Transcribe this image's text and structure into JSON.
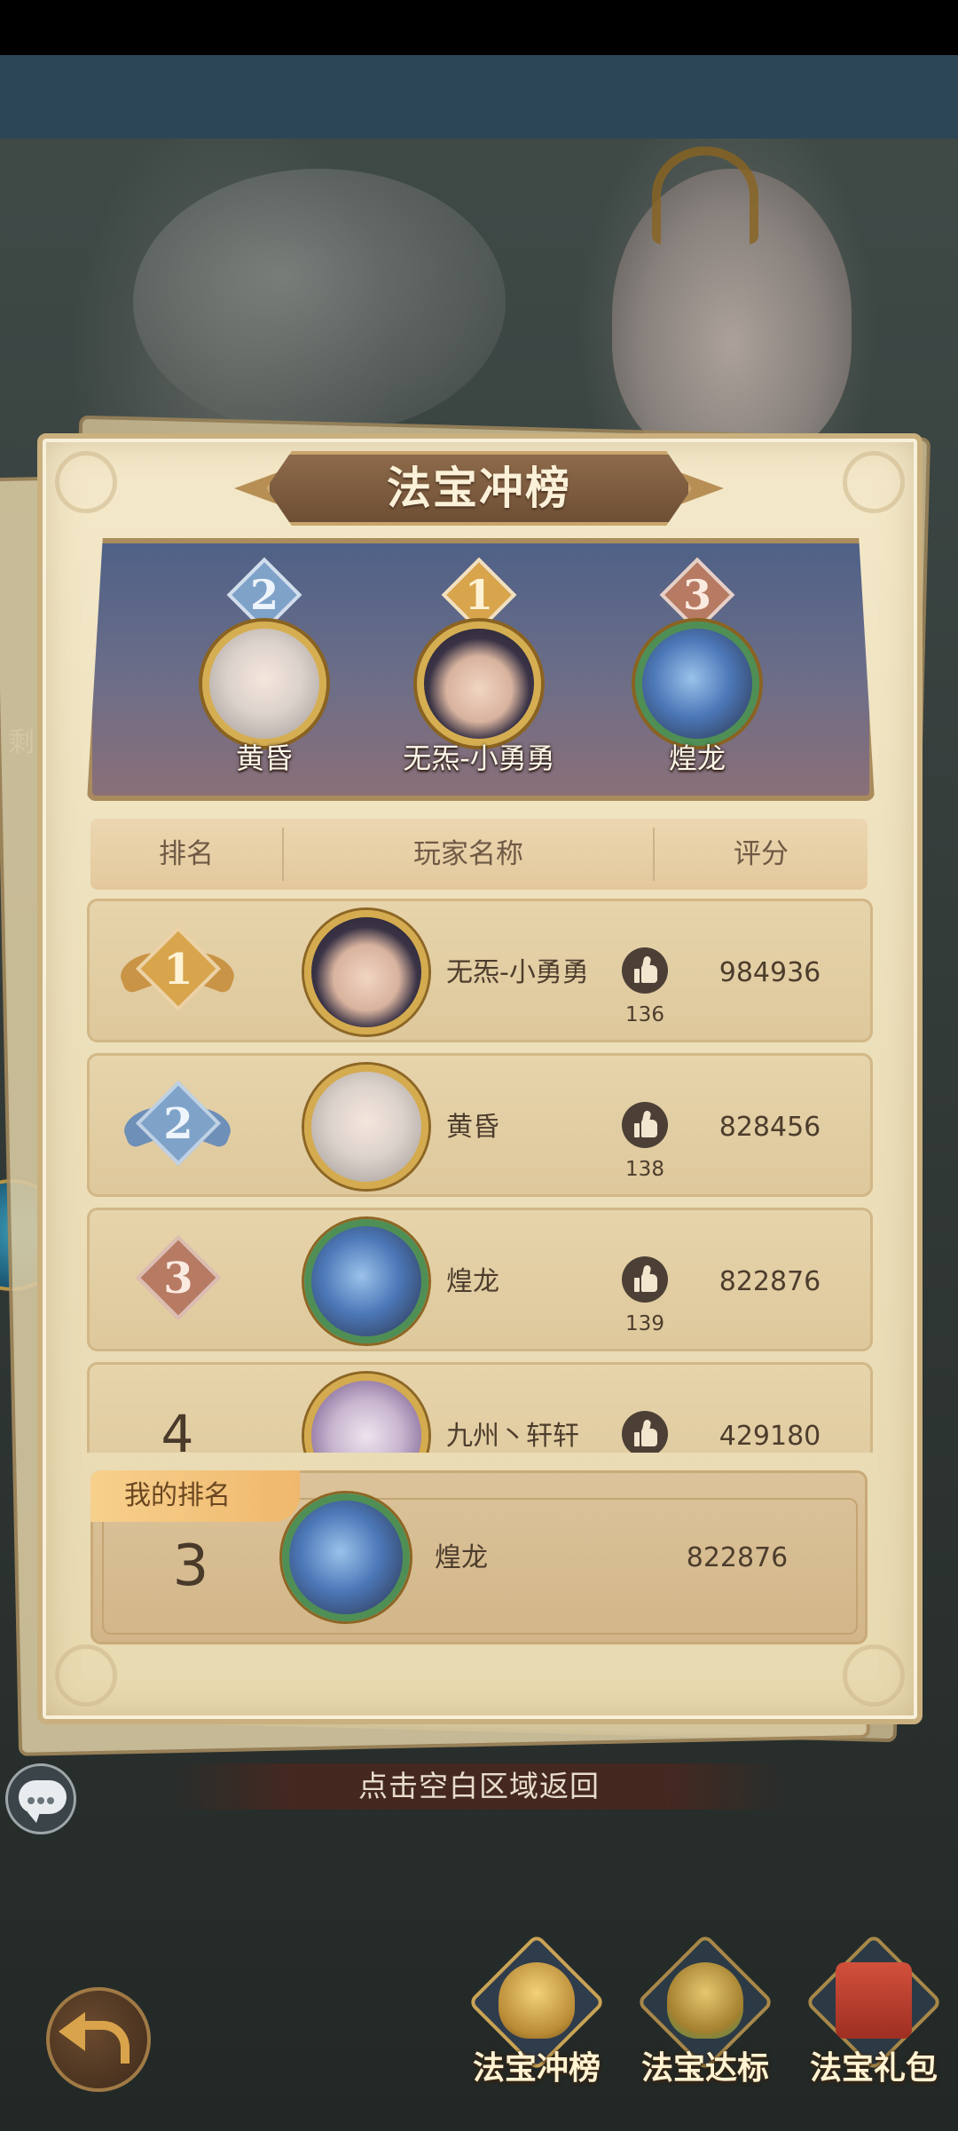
{
  "title": "法宝冲榜",
  "left_edge_tag": "剩",
  "podium": [
    {
      "rank": "2",
      "name": "黄昏",
      "badge_color": "#7fa2c9",
      "avatar": "white-hair-hero-avatar"
    },
    {
      "rank": "1",
      "name": "无炁-小勇勇",
      "badge_color": "#d8a54d",
      "avatar": "dark-hair-hero-avatar"
    },
    {
      "rank": "3",
      "name": "煌龙",
      "badge_color": "#b77a63",
      "avatar": "blue-dragon-avatar"
    }
  ],
  "table_headers": {
    "rank": "排名",
    "name": "玩家名称",
    "score": "评分"
  },
  "rows": [
    {
      "rank": "1",
      "name": "无炁-小勇勇",
      "likes": "136",
      "score": "984936",
      "badge_color": "#d8a54d"
    },
    {
      "rank": "2",
      "name": "黄昏",
      "likes": "138",
      "score": "828456",
      "badge_color": "#7fa2c9"
    },
    {
      "rank": "3",
      "name": "煌龙",
      "likes": "139",
      "score": "822876",
      "badge_color": "#b77a63"
    },
    {
      "rank": "4",
      "name": "九州丶轩轩",
      "likes": "",
      "score": "429180",
      "badge_color": ""
    }
  ],
  "my_rank": {
    "label": "我的排名",
    "rank": "3",
    "name": "煌龙",
    "score": "822876"
  },
  "return_hint": "点击空白区域返回",
  "bottom_nav": [
    {
      "label": "法宝冲榜",
      "active": true
    },
    {
      "label": "法宝达标",
      "active": false
    },
    {
      "label": "法宝礼包",
      "active": false
    }
  ],
  "colors": {
    "panel": "#ecdfba",
    "title_ribbon": "#7a5a3e",
    "gold_rank": "#d8a54d",
    "silver_rank": "#7fa2c9",
    "bronze_rank": "#b77a63",
    "text_dark": "#4d3d2d"
  }
}
